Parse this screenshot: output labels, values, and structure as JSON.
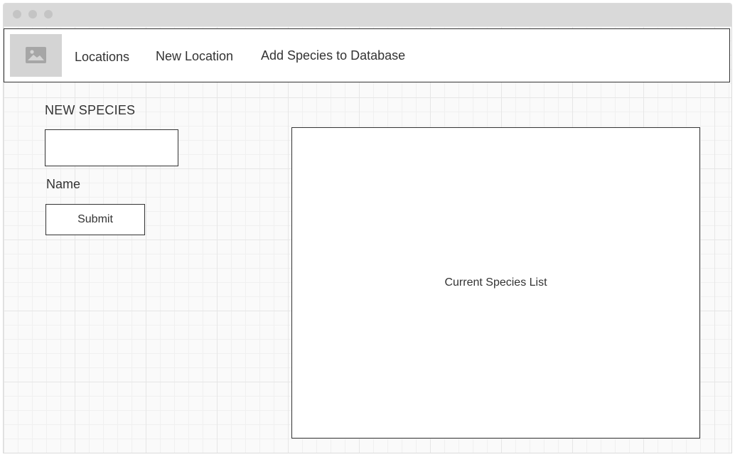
{
  "icons": {
    "logo": "image-placeholder-icon"
  },
  "nav": {
    "items": [
      {
        "label": "Locations"
      },
      {
        "label": "New Location"
      },
      {
        "label": "Add Species to Database"
      }
    ]
  },
  "form": {
    "title": "NEW SPECIES",
    "name_value": "",
    "name_placeholder": "",
    "name_label": "Name",
    "submit_label": "Submit"
  },
  "species_list": {
    "label": "Current Species List"
  },
  "colors": {
    "border": "#333333",
    "text": "#333333",
    "titlebar": "#d9d9d9",
    "placeholder_bg": "#d4d4d4"
  }
}
